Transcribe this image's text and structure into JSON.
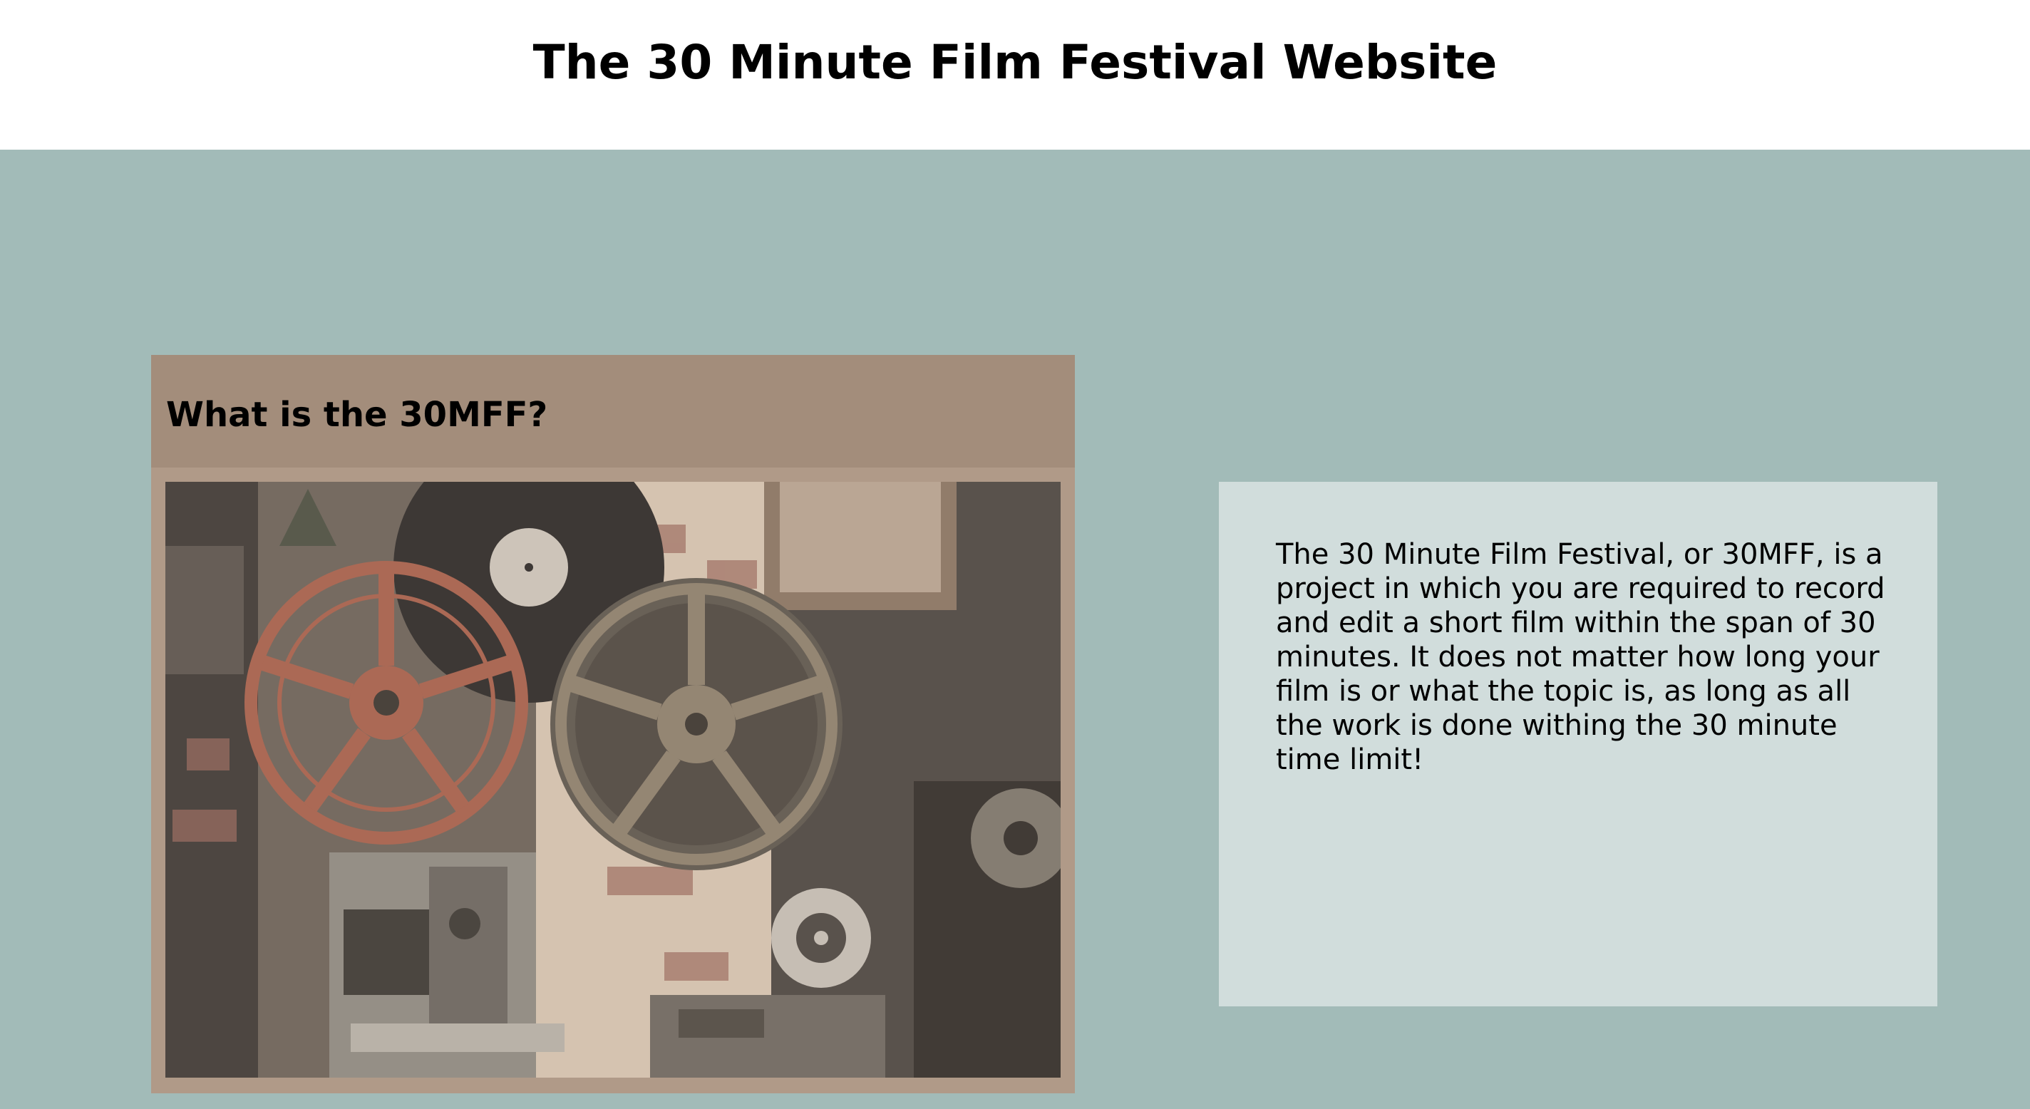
{
  "page": {
    "title": "The 30 Minute Film Festival Website"
  },
  "card": {
    "heading": "What is the 30MFF?",
    "image_subject": "vintage-film-reels-and-projectors-photo"
  },
  "description": {
    "text": "The 30 Minute Film Festival, or 30MFF, is a project in which you are required to record and edit a short film within the span of 30 minutes. It does not matter how long your film is or what the topic is, as long as all the work is done withing the 30 minute time limit!"
  },
  "colors": {
    "header_bg": "#ffffff",
    "section_bg": "#a2bbb8",
    "card_bg": "#b09a88",
    "card_header_bg": "#a38d7b",
    "panel_bg": "#d1dddc"
  }
}
